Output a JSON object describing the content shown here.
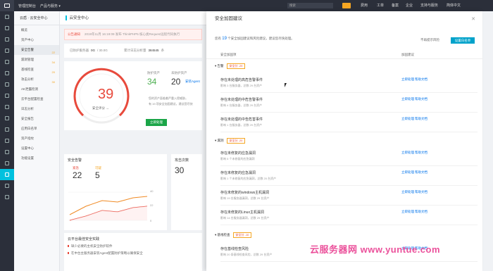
{
  "topbar": {
    "console_label": "管理控制台",
    "products_label": "产品与服务 ▾",
    "search_placeholder": "搜索",
    "nav": [
      "费用",
      "工单",
      "备案",
      "企业",
      "支持与服务",
      "简体中文"
    ]
  },
  "sidebar": {
    "title": "云盾 · 云安全中心",
    "items": [
      {
        "label": "概览",
        "count": ""
      },
      {
        "label": "资产中心",
        "count": ""
      },
      {
        "label": "安全告警",
        "count": "22"
      },
      {
        "label": "漏洞管理",
        "count": "34"
      },
      {
        "label": "基线检查",
        "count": "20"
      },
      {
        "label": "攻击分析",
        "count": "30"
      },
      {
        "label": "AK泄露检测",
        "count": ""
      },
      {
        "label": "云平台配置检查",
        "count": ""
      },
      {
        "label": "日志分析",
        "count": ""
      },
      {
        "label": "安全报告",
        "count": ""
      },
      {
        "label": "应用白名单",
        "count": ""
      },
      {
        "label": "资产指纹",
        "count": ""
      },
      {
        "label": "设置中心",
        "count": ""
      },
      {
        "label": "功能设置",
        "count": ""
      }
    ]
  },
  "main": {
    "title": "云安全中心",
    "notice_tag": "公告通知",
    "notice_text": "2019年11月 16:19:09 发布   ThinkPHP5 核心类Request远程代码执行",
    "stats": {
      "l1": "已防护服务器",
      "v1": "0G",
      "v2": "/ 30.0G",
      "l2": "累计日志分析量",
      "v3": "384545",
      "v4": "条"
    },
    "score": "39",
    "score_label": "安全评分 →",
    "protected_label": "防护资产",
    "protected_value": "34",
    "unprotected_label": "未防护资产",
    "unprotected_value": "20",
    "install_link": "安装Agent",
    "hint1": "您的资产面临着严重入侵威胁，",
    "hint2": "有 19 项安全加固建议，建议您尽快",
    "fix_button": "立即处理",
    "alerts_card": {
      "title": "安全告警",
      "urgent_label": "紧急",
      "urgent": "22",
      "medium_label": "可疑",
      "medium": "5"
    },
    "chart_right_labels": [
      "40",
      "22",
      "0"
    ],
    "attack_card": {
      "title": "攻击次数",
      "value": "30"
    },
    "bottom": {
      "title": "云平台最佳安全实践",
      "items": [
        "缺少必要的主机安全防护软件",
        "在中台主服务器安装Agent配置防护策略以确保安全"
      ]
    }
  },
  "panel": {
    "title": "安全加固建议",
    "intro_prefix": "您有",
    "intro_count": "19",
    "intro_suffix": "个安全加固建议和风险建议，建议您尽快处理。",
    "switch_label": "不再提示风险",
    "add_button": "设置白名单",
    "col_item": "安全加固项",
    "col_action": "加固建议",
    "groups": [
      {
        "name": "告警",
        "tag": "安全分 -29",
        "items": [
          {
            "name": "存在未处理的高危告警事件",
            "desc": "影响 3 台服务器，总数 29 台资产",
            "a1": "立即处理",
            "a2": "帮助文档"
          },
          {
            "name": "存在未处理的中危告警事件",
            "desc": "影响 4 台服务器，总数 29 台资产",
            "a1": "立即处理",
            "a2": "帮助文档"
          },
          {
            "name": "存在未处理的中告危害事件",
            "desc": "影响 1 台服务器，总数 29 台资产",
            "a1": "立即处理",
            "a2": "帮助文档"
          }
        ]
      },
      {
        "name": "漏洞",
        "tag": "安全分 -20",
        "items": [
          {
            "name": "存在未修复的应急漏洞",
            "desc": "影响 5 个未修复的应急漏洞",
            "a1": "立即处理",
            "a2": "帮助文档"
          },
          {
            "name": "存在未修复的应急漏洞",
            "desc": "影响 1 个未修复的应急漏洞，总数 20 台资产",
            "a1": "立即处理",
            "a2": "帮助文档"
          },
          {
            "name": "存在未修复的windows主机漏洞",
            "desc": "影响 19 台服务器漏洞，总数 29 台资产",
            "a1": "立即处理",
            "a2": "帮助文档"
          },
          {
            "name": "存在未修复的Linux主机漏洞",
            "desc": "影响 14 台服务器漏洞，总数 29 台资产",
            "a1": "立即处理",
            "a2": "帮助文档"
          }
        ]
      },
      {
        "name": "基线检查",
        "tag": "安全分 -10",
        "items": [
          {
            "name": "存在基线检查风险",
            "desc": "影响 20 条基线检查风险，总数 29 台资产",
            "a1": "立即处理",
            "a2": "帮助文档"
          }
        ]
      }
    ]
  },
  "watermark": "云服务器网 www.yuntue.com"
}
